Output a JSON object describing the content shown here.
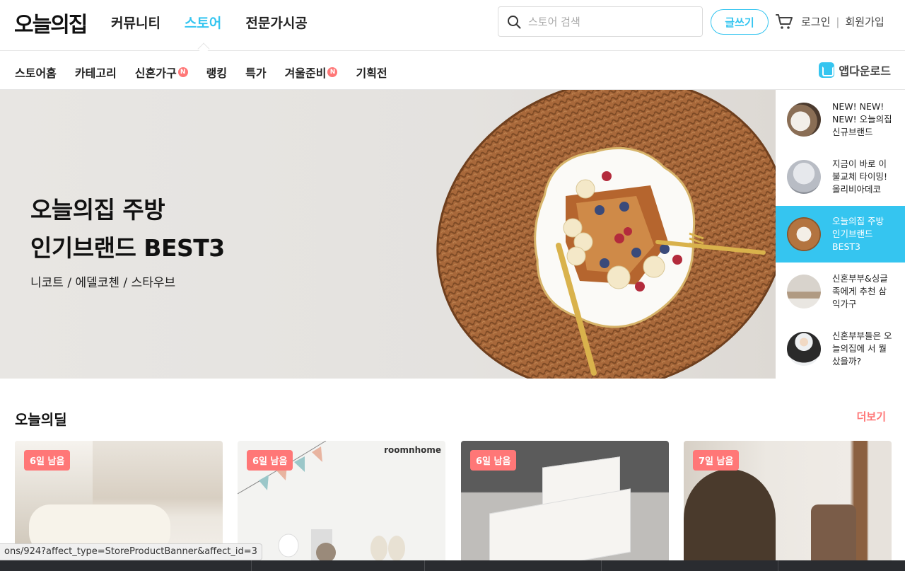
{
  "header": {
    "logo": "오늘의집",
    "nav": [
      {
        "label": "커뮤니티",
        "active": false
      },
      {
        "label": "스토어",
        "active": true
      },
      {
        "label": "전문가시공",
        "active": false
      }
    ],
    "search_placeholder": "스토어 검색",
    "write_label": "글쓰기",
    "login_label": "로그인",
    "separator": "|",
    "signup_label": "회원가입"
  },
  "subnav": {
    "items": [
      {
        "label": "스토어홈",
        "new": false
      },
      {
        "label": "카테고리",
        "new": false
      },
      {
        "label": "신혼가구",
        "new": true
      },
      {
        "label": "랭킹",
        "new": false
      },
      {
        "label": "특가",
        "new": false
      },
      {
        "label": "겨울준비",
        "new": true
      },
      {
        "label": "기획전",
        "new": false
      }
    ],
    "new_badge": "N",
    "app_download": "앱다운로드"
  },
  "hero": {
    "title_line1": "오늘의집 주방",
    "title_line2": "인기브랜드 BEST3",
    "subtitle": "니코트 / 에델코첸 / 스타우브"
  },
  "side_list": [
    {
      "label": "NEW! NEW! NEW!  오늘의집 신규브랜드",
      "active": false
    },
    {
      "label": "지금이 바로 이불교체 타이밍! 올리비아데코",
      "active": false
    },
    {
      "label": "오늘의집 주방  인기브랜드 BEST3",
      "active": true
    },
    {
      "label": "신혼부부&싱글족에게 추천 삼익가구",
      "active": false
    },
    {
      "label": "신혼부부들은 오늘의집에 서 뭘 샀을까?",
      "active": false
    }
  ],
  "deal_section": {
    "title": "오늘의딜",
    "more": "더보기",
    "cards": [
      {
        "tag": "6일 남음",
        "brand": ""
      },
      {
        "tag": "6일 남음",
        "brand": "roomnhome"
      },
      {
        "tag": "6일 남음",
        "brand": ""
      },
      {
        "tag": "7일 남음",
        "brand": ""
      }
    ]
  },
  "status_url": "ons/924?affect_type=StoreProductBanner&affect_id=3",
  "colors": {
    "accent": "#35c5f0",
    "badge": "#ff7777"
  }
}
